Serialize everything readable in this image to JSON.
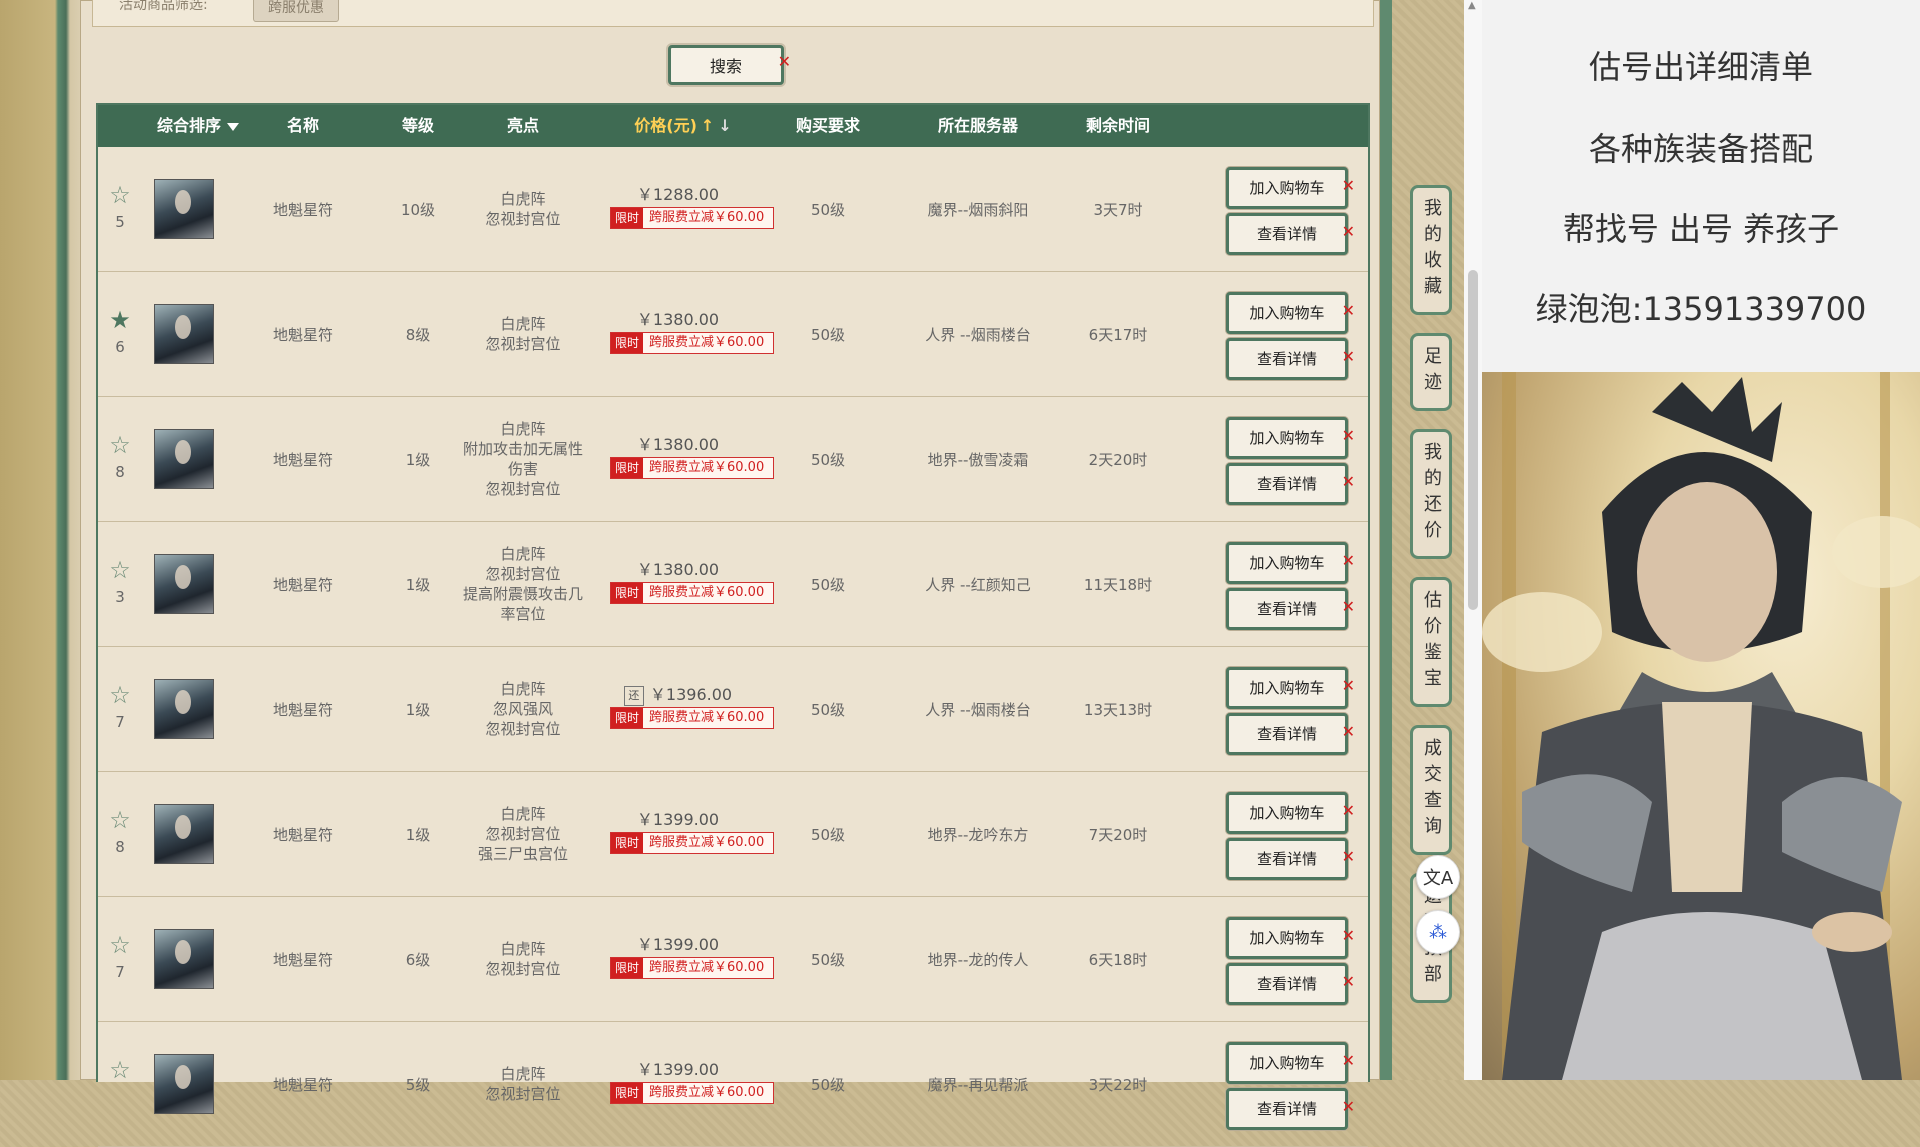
{
  "filter": {
    "label": "活动商品筛选:",
    "chip": "跨服优惠"
  },
  "search": {
    "label": "搜索"
  },
  "table": {
    "headers": {
      "sort": "综合排序",
      "name": "名称",
      "level": "等级",
      "highlight": "亮点",
      "price": "价格(元)",
      "requirement": "购买要求",
      "server": "所在服务器",
      "time": "剩余时间"
    },
    "promo_tag": "限时",
    "promo_text": "跨服费立减￥60.00",
    "cart_label": "加入购物车",
    "detail_label": "查看详情",
    "rows": [
      {
        "rank": "5",
        "favorited": false,
        "name": "地魁星符",
        "level": "10级",
        "highlight": [
          "白虎阵",
          "忽视封宫位"
        ],
        "price": "￥1288.00",
        "haggle": false,
        "requirement": "50级",
        "server": "魔界--烟雨斜阳",
        "time": "3天7时"
      },
      {
        "rank": "6",
        "favorited": true,
        "name": "地魁星符",
        "level": "8级",
        "highlight": [
          "白虎阵",
          "忽视封宫位"
        ],
        "price": "￥1380.00",
        "haggle": false,
        "requirement": "50级",
        "server": "人界 --烟雨楼台",
        "time": "6天17时"
      },
      {
        "rank": "8",
        "favorited": false,
        "name": "地魁星符",
        "level": "1级",
        "highlight": [
          "白虎阵",
          "附加攻击加无属性",
          "伤害",
          "忽视封宫位"
        ],
        "price": "￥1380.00",
        "haggle": false,
        "requirement": "50级",
        "server": "地界--傲雪凌霜",
        "time": "2天20时"
      },
      {
        "rank": "3",
        "favorited": false,
        "name": "地魁星符",
        "level": "1级",
        "highlight": [
          "白虎阵",
          "忽视封宫位",
          "提高附震慑攻击几",
          "率宫位"
        ],
        "price": "￥1380.00",
        "haggle": false,
        "requirement": "50级",
        "server": "人界 --红颜知己",
        "time": "11天18时"
      },
      {
        "rank": "7",
        "favorited": false,
        "name": "地魁星符",
        "level": "1级",
        "highlight": [
          "白虎阵",
          "忽风强风",
          "忽视封宫位"
        ],
        "price": "￥1396.00",
        "haggle": true,
        "haggle_label": "还",
        "requirement": "50级",
        "server": "人界 --烟雨楼台",
        "time": "13天13时"
      },
      {
        "rank": "8",
        "favorited": false,
        "name": "地魁星符",
        "level": "1级",
        "highlight": [
          "白虎阵",
          "忽视封宫位",
          "强三尸虫宫位"
        ],
        "price": "￥1399.00",
        "haggle": false,
        "requirement": "50级",
        "server": "地界--龙吟东方",
        "time": "7天20时"
      },
      {
        "rank": "7",
        "favorited": false,
        "name": "地魁星符",
        "level": "6级",
        "highlight": [
          "白虎阵",
          "忽视封宫位"
        ],
        "price": "￥1399.00",
        "haggle": false,
        "requirement": "50级",
        "server": "地界--龙的传人",
        "time": "6天18时"
      },
      {
        "rank": "",
        "favorited": false,
        "name": "地魁星符",
        "level": "5级",
        "highlight": [
          "白虎阵",
          "忽视封宫位"
        ],
        "price": "￥1399.00",
        "haggle": false,
        "requirement": "50级",
        "server": "魔界--再见帮派",
        "time": "3天22时"
      }
    ]
  },
  "side_nav": [
    "我的收藏",
    "足迹",
    "我的还价",
    "估价鉴宝",
    "成交查询",
    "返回顶部"
  ],
  "float_buttons": [
    "translate-icon",
    "network-icon"
  ],
  "float_glyphs": {
    "translate": "文A",
    "network": "⁂"
  },
  "info": {
    "lines": [
      "估号出详细清单",
      "各种族装备搭配",
      "帮找号 出号 养孩子",
      "绿泡泡:13591339700"
    ]
  },
  "colors": {
    "header_green": "#3f6b53",
    "accent_red": "#d02020",
    "frame_green": "#5f8a6f"
  }
}
